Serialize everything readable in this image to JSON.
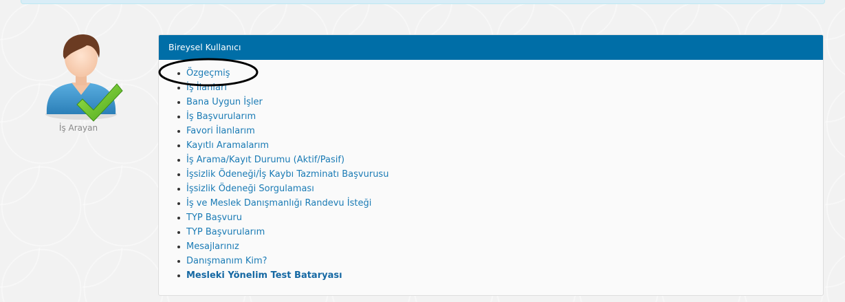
{
  "sidebar": {
    "role_label": "İş Arayan",
    "avatar_icon": "job-seeker-checkmark-icon"
  },
  "panel": {
    "title": "Bireysel Kullanıcı",
    "header_color": "#006ea7",
    "items": [
      {
        "label": "Özgeçmiş"
      },
      {
        "label": "İş İlanları"
      },
      {
        "label": "Bana Uygun İşler"
      },
      {
        "label": "İş Başvurularım"
      },
      {
        "label": "Favori İlanlarım"
      },
      {
        "label": "Kayıtlı Aramalarım"
      },
      {
        "label": "İş Arama/Kayıt Durumu (Aktif/Pasif)"
      },
      {
        "label": "İşsizlik Ödeneği/İş Kaybı Tazminatı Başvurusu"
      },
      {
        "label": "İşsizlik Ödeneği Sorgulaması"
      },
      {
        "label": "İş ve Meslek Danışmanlığı Randevu İsteği"
      },
      {
        "label": "TYP Başvuru"
      },
      {
        "label": "TYP Başvurularım"
      },
      {
        "label": "Mesajlarınız"
      },
      {
        "label": "Danışmanım Kim?"
      },
      {
        "label": "Mesleki Yönelim Test Bataryası",
        "bold": true
      }
    ]
  },
  "annotation": {
    "highlighted_item": "Özgeçmiş"
  }
}
